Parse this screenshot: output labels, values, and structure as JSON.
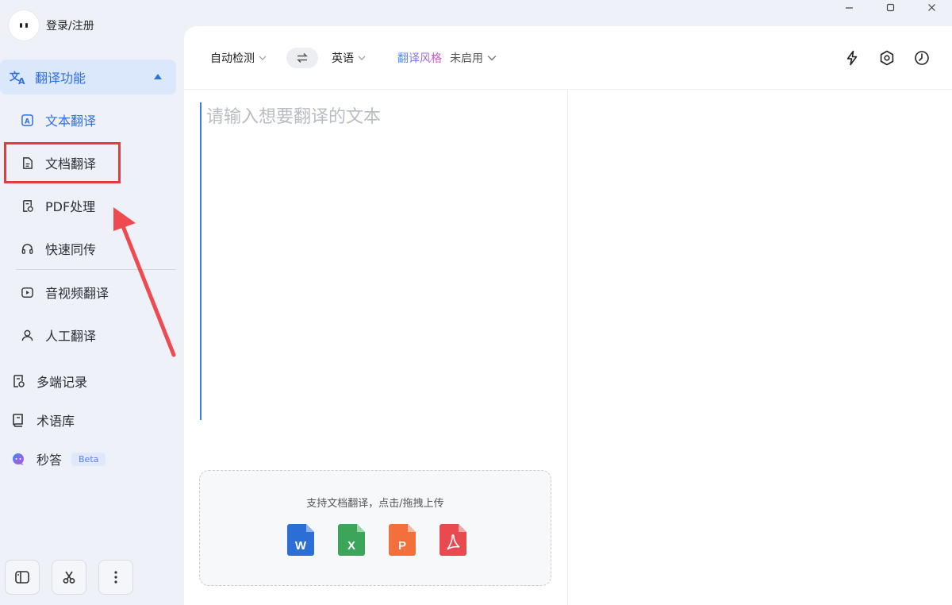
{
  "window": {
    "controls": [
      "minimize-icon",
      "maximize-icon",
      "close-icon"
    ]
  },
  "user": {
    "login_label": "登录/注册"
  },
  "sidebar": {
    "group": {
      "label": "翻译功能",
      "icon": "translate-icon",
      "accent": "#2f6fe8"
    },
    "sub_items": [
      {
        "label": "文本翻译",
        "icon": "text-translate-icon",
        "active": true
      },
      {
        "label": "文档翻译",
        "icon": "document-icon"
      },
      {
        "label": "PDF处理",
        "icon": "pdf-doc-icon"
      },
      {
        "label": "快速同传",
        "icon": "headset-icon"
      },
      {
        "label": "音视频翻译",
        "icon": "video-play-icon"
      },
      {
        "label": "人工翻译",
        "icon": "person-icon"
      }
    ],
    "main_items": [
      {
        "label": "多端记录",
        "icon": "records-icon"
      },
      {
        "label": "术语库",
        "icon": "book-icon"
      },
      {
        "label": "秒答",
        "icon": "chat-ai-icon",
        "badge": "Beta"
      }
    ],
    "bottom_tools": [
      "sidebar-toggle-icon",
      "scissors-icon",
      "more-vertical-icon"
    ]
  },
  "annotation": {
    "highlight_color": "#e43c3c"
  },
  "toolbar": {
    "source_lang": "自动检测",
    "target_lang": "英语",
    "style_label": "翻译风格",
    "style_value": "未启用",
    "right_icons": [
      "lightning-icon",
      "settings-icon",
      "history-icon"
    ]
  },
  "editor": {
    "placeholder": "请输入想要翻译的文本"
  },
  "upload": {
    "hint": "支持文档翻译，点击/拖拽上传",
    "file_types": [
      {
        "name": "word-file-icon",
        "letter": "W",
        "color": "#2b6fd6"
      },
      {
        "name": "excel-file-icon",
        "letter": "X",
        "color": "#3da55a"
      },
      {
        "name": "ppt-file-icon",
        "letter": "P",
        "color": "#f36f3c"
      },
      {
        "name": "pdf-file-icon",
        "letter": "",
        "color": "#e84a4f"
      }
    ]
  }
}
